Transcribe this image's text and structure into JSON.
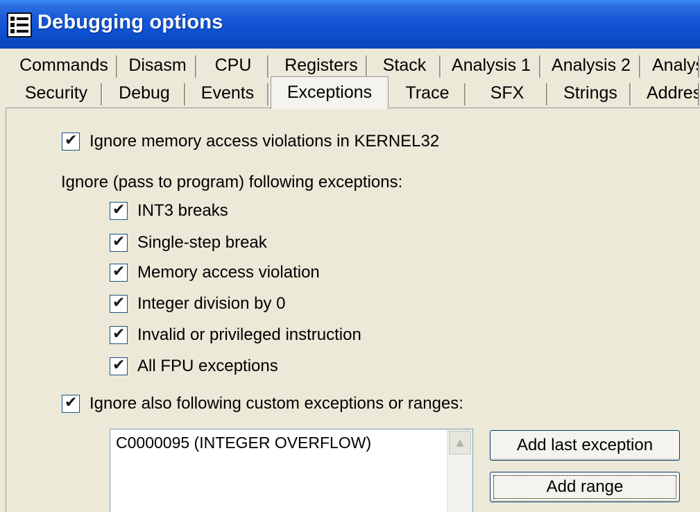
{
  "window": {
    "title": "Debugging options",
    "icon": "list-window-icon"
  },
  "tabs": {
    "row1": [
      "Commands",
      "Disasm",
      "CPU",
      "Registers",
      "Stack",
      "Analysis 1",
      "Analysis 2",
      "Analys"
    ],
    "row2": [
      "Security",
      "Debug",
      "Events",
      "Exceptions",
      "Trace",
      "SFX",
      "Strings",
      "Addres"
    ],
    "active": "Exceptions"
  },
  "options": {
    "ignore_kernel32": {
      "label": "Ignore memory access violations in KERNEL32",
      "checked": true
    },
    "ignore_group_label": "Ignore (pass to program) following exceptions:",
    "exceptions": [
      {
        "label": "INT3 breaks",
        "checked": true
      },
      {
        "label": "Single-step break",
        "checked": true
      },
      {
        "label": "Memory access violation",
        "checked": true
      },
      {
        "label": "Integer division by 0",
        "checked": true
      },
      {
        "label": "Invalid or privileged instruction",
        "checked": true
      },
      {
        "label": "All FPU exceptions",
        "checked": true
      }
    ],
    "custom": {
      "label": "Ignore also following custom exceptions or ranges:",
      "checked": true
    }
  },
  "custom_list": {
    "items": [
      "C0000095 (INTEGER OVERFLOW)"
    ]
  },
  "buttons": {
    "add_last": "Add last exception",
    "add_range": "Add range"
  }
}
